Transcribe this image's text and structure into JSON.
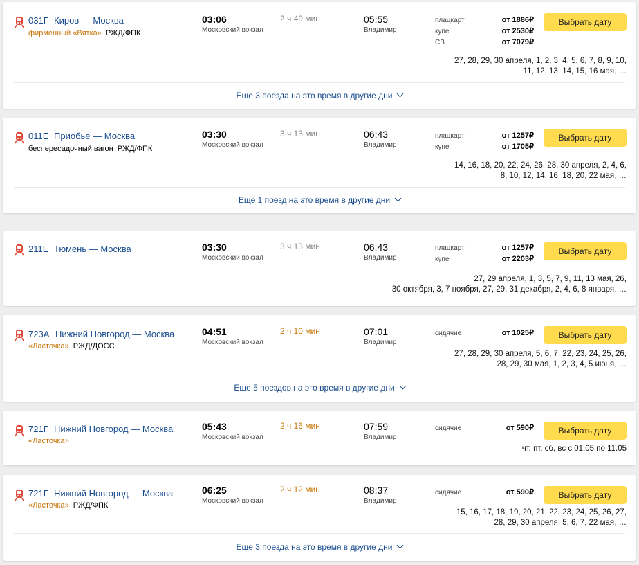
{
  "trains": [
    {
      "number": "031Г",
      "route": "Киров — Москва",
      "brand_name": "фирменный «Вятка»",
      "brand_carrier": "РЖД/ФПК",
      "departure": "03:06",
      "departure_station": "Московский вокзал",
      "duration": "2 ч 49 мин",
      "arrival": "05:55",
      "arrival_station": "Владимир",
      "classes": [
        "плацкарт",
        "купе",
        "СВ"
      ],
      "prices": [
        "от 1886₽",
        "от 2530₽",
        "от 7079₽"
      ],
      "button": "Выбрать дату",
      "dates": [
        "27, 28, 29, 30 апреля, 1, 2, 3, 4, 5, 6, 7, 8, 9, 10,",
        "11, 12, 13, 14, 15, 16 мая, …"
      ],
      "more": "Еще 3 поезда на это время в другие дни"
    },
    {
      "number": "011Е",
      "route": "Приобье — Москва",
      "brand_name": "беспересадочный вагон",
      "brand_carrier": "РЖД/ФПК",
      "departure": "03:30",
      "departure_station": "Московский вокзал",
      "duration": "3 ч 13 мин",
      "arrival": "06:43",
      "arrival_station": "Владимир",
      "classes": [
        "плацкарт",
        "купе"
      ],
      "prices": [
        "от 1257₽",
        "от 1705₽"
      ],
      "button": "Выбрать дату",
      "dates": [
        "14, 16, 18, 20, 22, 24, 26, 28, 30 апреля, 2, 4, 6,",
        "8, 10, 12, 14, 16, 18, 20, 22 мая, …"
      ],
      "more": "Еще 1 поезд на это время в другие дни"
    },
    {
      "number": "211Е",
      "route": "Тюмень — Москва",
      "departure": "03:30",
      "departure_station": "Московский вокзал",
      "duration": "3 ч 13 мин",
      "arrival": "06:43",
      "arrival_station": "Владимир",
      "classes": [
        "плацкарт",
        "купе"
      ],
      "prices": [
        "от 1257₽",
        "от 2203₽"
      ],
      "button": "Выбрать дату",
      "dates": [
        "27, 29 апреля, 1, 3, 5, 7, 9, 11, 13 мая, 26,",
        "30 октября, 3, 7 ноября, 27, 29, 31 декабря, 2, 4, 6, 8 января, …"
      ]
    },
    {
      "number": "723А",
      "route": "Нижний Новгород — Москва",
      "brand_name": "«Ласточка»",
      "brand_carrier": "РЖД/ДОСС",
      "departure": "04:51",
      "departure_station": "Московский вокзал",
      "duration": "2 ч 10 мин",
      "arrival": "07:01",
      "arrival_station": "Владимир",
      "classes": [
        "сидячие"
      ],
      "prices": [
        "от 1025₽"
      ],
      "button": "Выбрать дату",
      "dates": [
        "27, 28, 29, 30 апреля, 5, 6, 7, 22, 23, 24, 25, 26,",
        "28, 29, 30 мая, 1, 2, 3, 4, 5 июня, …"
      ],
      "more": "Еще 5 поездов на это время в другие дни"
    },
    {
      "number": "721Г",
      "route": "Нижний Новгород — Москва",
      "brand_name": "«Ласточка»",
      "departure": "05:43",
      "departure_station": "Московский вокзал",
      "duration": "2 ч 16 мин",
      "arrival": "07:59",
      "arrival_station": "Владимир",
      "classes": [
        "сидячие"
      ],
      "prices": [
        "от 590₽"
      ],
      "button": "Выбрать дату",
      "dates": [
        "чт, пт, сб, вс с 01.05 по 11.05"
      ]
    },
    {
      "number": "721Г",
      "route": "Нижний Новгород — Москва",
      "brand_name": "«Ласточка»",
      "brand_carrier": "РЖД/ФПК",
      "departure": "06:25",
      "departure_station": "Московский вокзал",
      "duration": "2 ч 12 мин",
      "arrival": "08:37",
      "arrival_station": "Владимир",
      "classes": [
        "сидячие"
      ],
      "prices": [
        "от 590₽"
      ],
      "button": "Выбрать дату",
      "dates": [
        "15, 16, 17, 18, 19, 20, 21, 22, 23, 24, 25, 26, 27,",
        "28, 29, 30 апреля, 5, 6, 7, 22 мая, …"
      ],
      "more": "Еще 3 поезда на это время в другие дни"
    }
  ],
  "colors": {
    "link": "#1a4d8f",
    "brand_orange": "#c8760a",
    "button": "#ffdb4d",
    "train_icon": "#e04a3a"
  },
  "icons": {
    "train": "train-icon",
    "expand": "chevron-down-icon"
  }
}
